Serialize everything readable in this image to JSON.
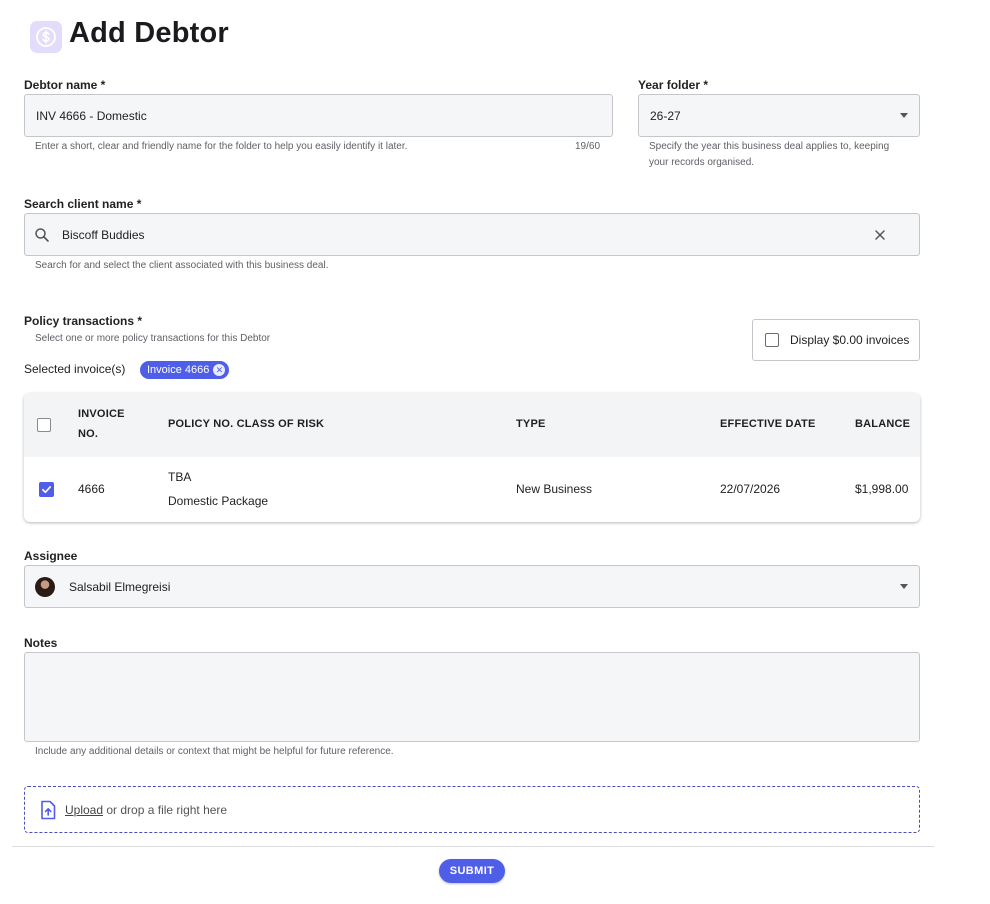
{
  "page": {
    "title": "Add Debtor",
    "icon": "dollar-coin-icon"
  },
  "debtor_name": {
    "label": "Debtor name *",
    "value": "INV 4666 - Domestic",
    "helper": "Enter a short, clear and friendly name for the folder to help you easily identify it later.",
    "counter": "19/60"
  },
  "year_folder": {
    "label": "Year folder *",
    "value": "26-27",
    "helper_line1": "Specify the year this business deal applies to, keeping",
    "helper_line2": "your records organised."
  },
  "client_search": {
    "label": "Search client name *",
    "value": "Biscoff Buddies",
    "helper": "Search for and select the client associated with this business deal."
  },
  "policy": {
    "label": "Policy transactions *",
    "helper": "Select one or more policy transactions for this Debtor",
    "display_zero_label": "Display $0.00 invoices",
    "selected_label": "Selected invoice(s)",
    "selected_chips": [
      "Invoice 4666"
    ]
  },
  "table": {
    "headers": {
      "invoice_line1": "INVOICE",
      "invoice_line2": "NO.",
      "policy": "POLICY NO. CLASS OF RISK",
      "type": "TYPE",
      "effective_date": "EFFECTIVE DATE",
      "balance": "BALANCE"
    },
    "rows": [
      {
        "checked": true,
        "invoice_no": "4666",
        "policy_no": "TBA",
        "class_of_risk": "Domestic Package",
        "type": "New Business",
        "effective_date": "22/07/2026",
        "balance": "$1,998.00"
      }
    ]
  },
  "assignee": {
    "label": "Assignee",
    "value": "Salsabil Elmegreisi"
  },
  "notes": {
    "label": "Notes",
    "value": "",
    "helper": "Include any additional details or context that might be helpful for future reference."
  },
  "upload": {
    "link": "Upload",
    "text": " or drop a file right here"
  },
  "submit": {
    "label": "SUBMIT"
  },
  "colors": {
    "accent": "#4f5ee8",
    "icon_bg": "#e4dcfb",
    "field_bg": "#f5f6f8"
  }
}
